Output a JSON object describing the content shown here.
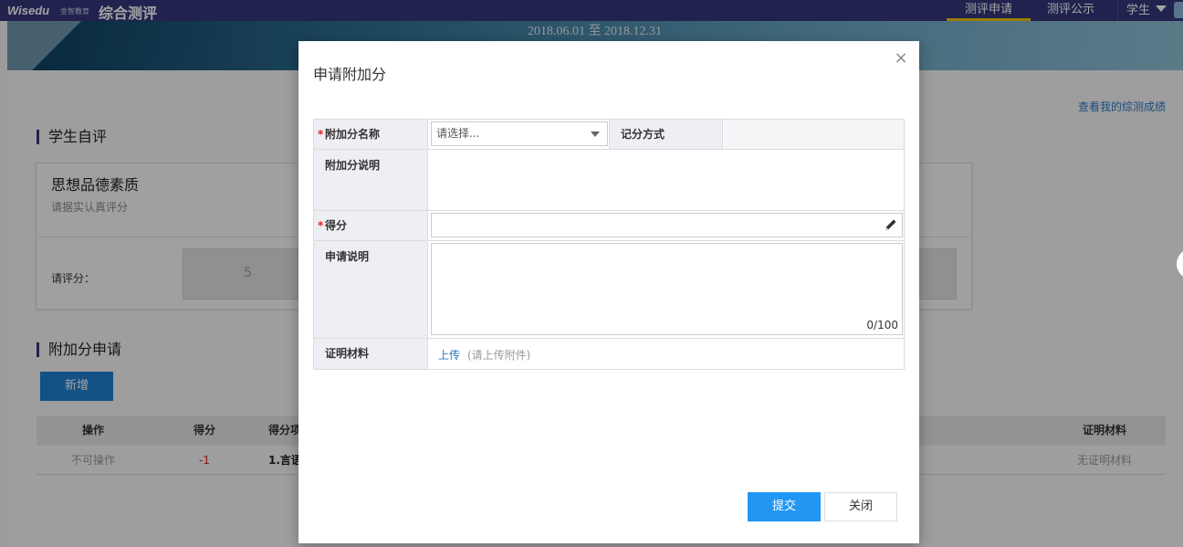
{
  "header": {
    "logo_text": "Wisedu",
    "logo_sub": "金智教育",
    "app_title": "综合测评",
    "tabs": [
      {
        "label": "测评申请",
        "active": true
      },
      {
        "label": "测评公示",
        "active": false
      }
    ],
    "user_role": "学生"
  },
  "banner": {
    "period": "2018.06.01 至 2018.12.31"
  },
  "page": {
    "my_results_link": "查看我的综测成绩",
    "self_eval": {
      "section_title": "学生自评",
      "card_title": "思想品德素质",
      "card_hint": "请据实认真评分",
      "rate_label": "请评分：",
      "score_value": "5"
    },
    "bonus": {
      "section_title": "附加分申请",
      "add_button": "新增",
      "columns": [
        "操作",
        "得分",
        "得分项",
        "证明材料"
      ],
      "rows": [
        {
          "action": "不可操作",
          "score": "-1",
          "item": "1.言语",
          "material": "无证明材料"
        }
      ]
    }
  },
  "modal": {
    "title": "申请附加分",
    "close_symbol": "×",
    "fields": {
      "bonus_name_label": "附加分名称",
      "bonus_name_placeholder": "请选择...",
      "scoring_method_label": "记分方式",
      "bonus_desc_label": "附加分说明",
      "score_label": "得分",
      "apply_desc_label": "申请说明",
      "apply_desc_counter": "0/100",
      "proof_label": "证明材料",
      "upload_link": "上传",
      "upload_hint": "(请上传附件)"
    },
    "submit_button": "提交",
    "close_button": "关闭"
  },
  "colors": {
    "topbar": "#34387a",
    "primary_button": "#2196f3",
    "required_star": "#e02424",
    "link": "#2a78c5",
    "negative_score": "#e02424"
  }
}
